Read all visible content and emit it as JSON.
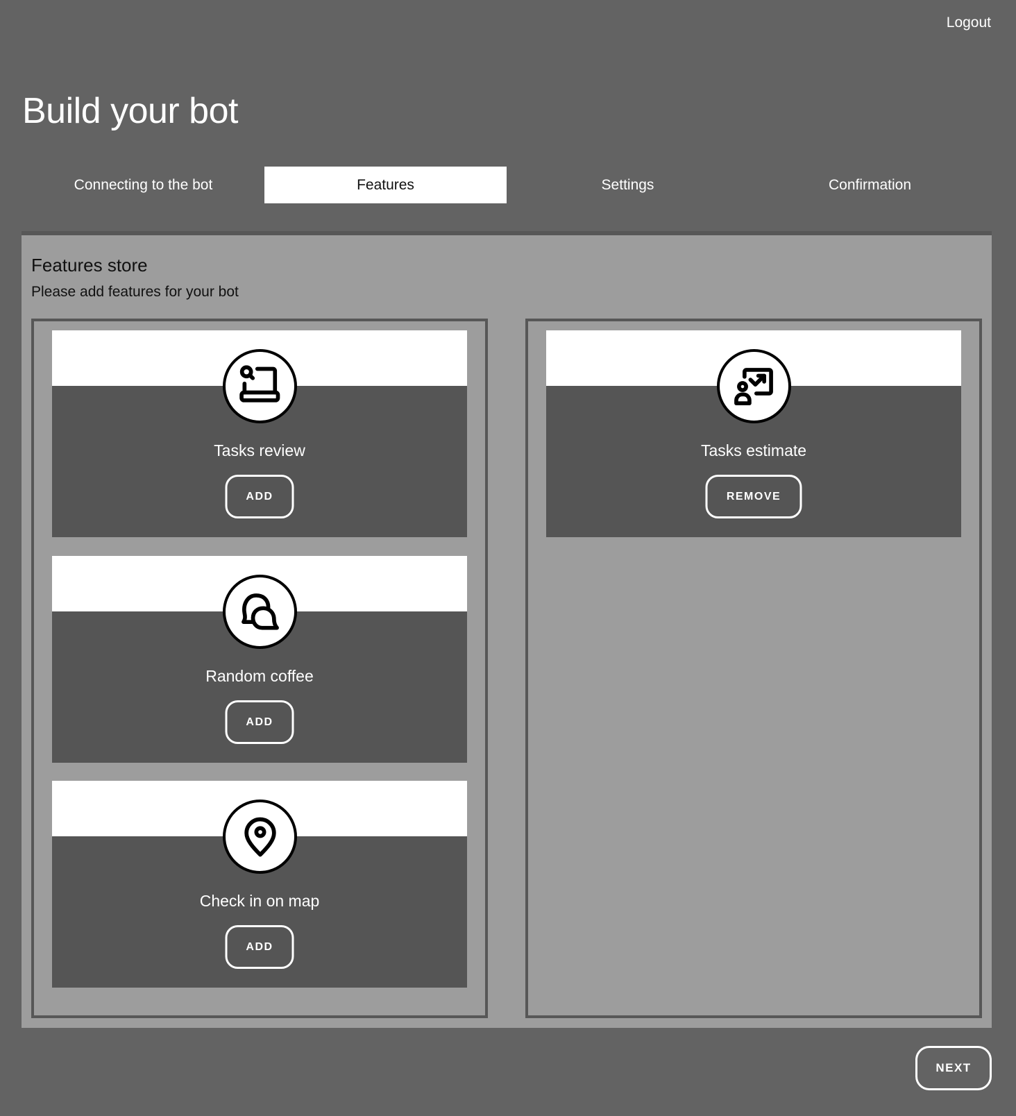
{
  "header": {
    "logout_label": "Logout",
    "title": "Build your bot"
  },
  "tabs": [
    {
      "label": "Connecting to the bot",
      "active": false
    },
    {
      "label": "Features",
      "active": true
    },
    {
      "label": "Settings",
      "active": false
    },
    {
      "label": "Confirmation",
      "active": false
    }
  ],
  "features_store": {
    "title": "Features store",
    "subtitle": "Please add features for your bot",
    "available": [
      {
        "name": "Tasks review",
        "icon": "laptop-search-icon",
        "button_label": "ADD"
      },
      {
        "name": "Random coffee",
        "icon": "chat-bubbles-icon",
        "button_label": "ADD"
      },
      {
        "name": "Check in on map",
        "icon": "map-pin-icon",
        "button_label": "ADD"
      }
    ],
    "selected": [
      {
        "name": "Tasks estimate",
        "icon": "presentation-chart-icon",
        "button_label": "REMOVE"
      }
    ]
  },
  "footer": {
    "next_label": "NEXT"
  },
  "colors": {
    "page_bg": "#636363",
    "panel_bg": "#9d9d9d",
    "card_bg": "#555555",
    "active_tab_bg": "#ffffff"
  }
}
